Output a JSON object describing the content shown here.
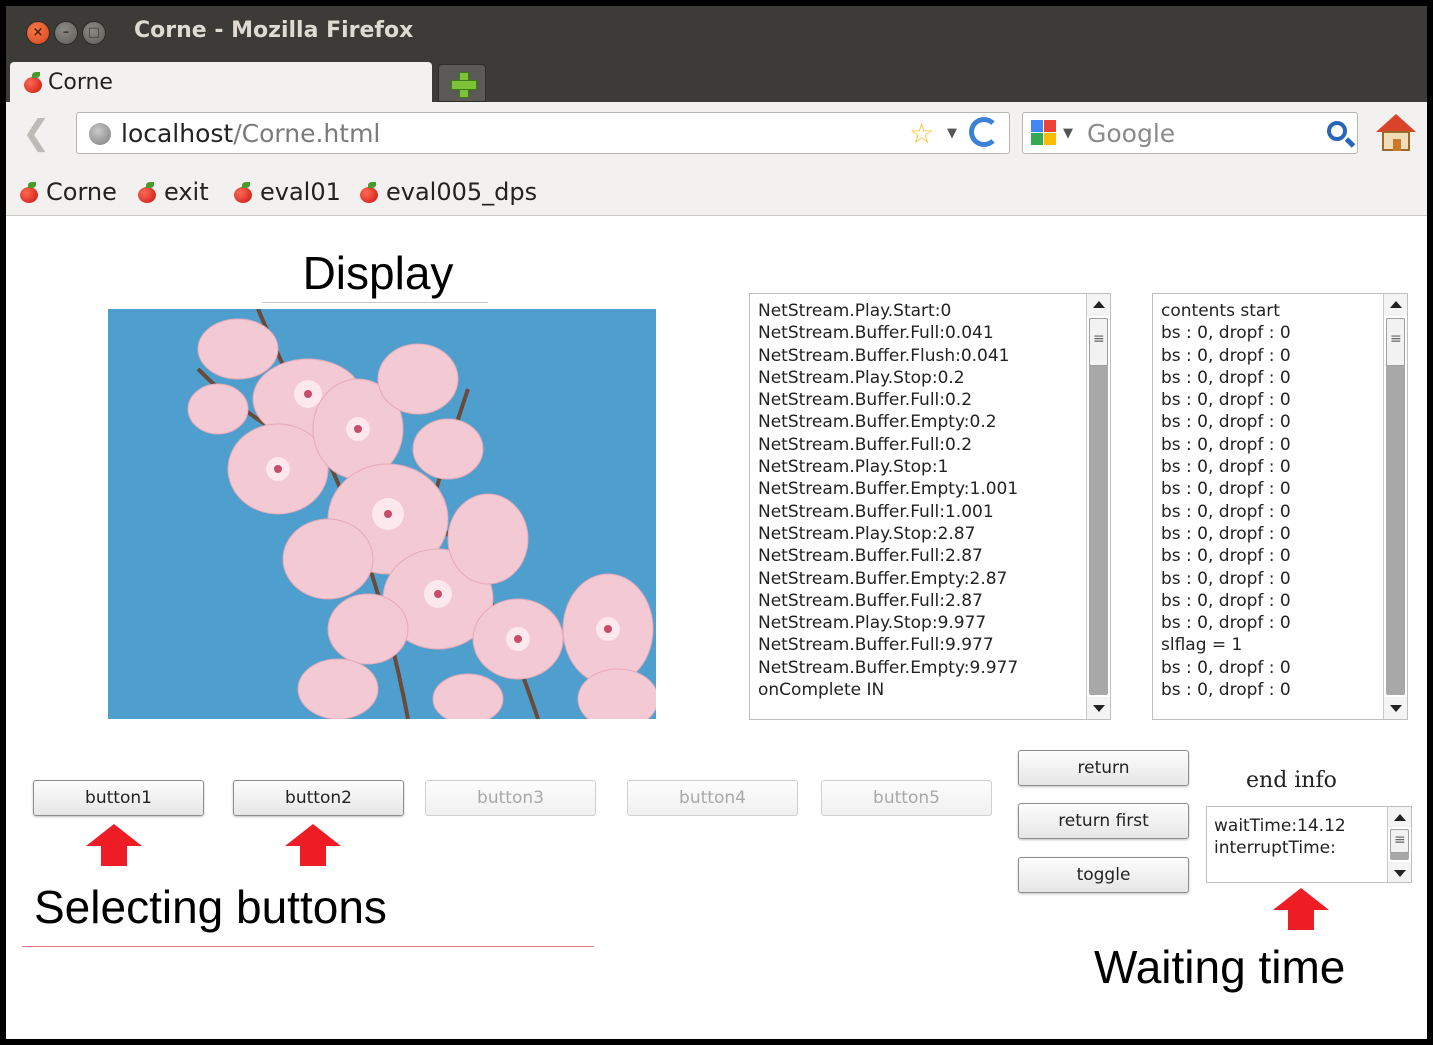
{
  "window": {
    "title": "Corne - Mozilla Firefox",
    "controls": {
      "close": "×",
      "minimize": "–",
      "maximize": "□"
    }
  },
  "tabs": [
    {
      "label": "Corne"
    }
  ],
  "navbar": {
    "url_host": "localhost",
    "url_path": "/Corne.html",
    "search_placeholder": "Google"
  },
  "bookmarks": [
    {
      "label": "Corne"
    },
    {
      "label": "exit"
    },
    {
      "label": "eval01"
    },
    {
      "label": "eval005_dps"
    }
  ],
  "annotations": {
    "display": "Display",
    "selecting_buttons": "Selecting buttons",
    "waiting_time": "Waiting time"
  },
  "log_left": [
    "NetStream.Play.Start:0",
    "NetStream.Buffer.Full:0.041",
    "NetStream.Buffer.Flush:0.041",
    "NetStream.Play.Stop:0.2",
    "NetStream.Buffer.Full:0.2",
    "NetStream.Buffer.Empty:0.2",
    "NetStream.Buffer.Full:0.2",
    "NetStream.Play.Stop:1",
    "NetStream.Buffer.Empty:1.001",
    "NetStream.Buffer.Full:1.001",
    "NetStream.Play.Stop:2.87",
    "NetStream.Buffer.Full:2.87",
    "NetStream.Buffer.Empty:2.87",
    "NetStream.Buffer.Full:2.87",
    "NetStream.Play.Stop:9.977",
    "NetStream.Buffer.Full:9.977",
    "NetStream.Buffer.Empty:9.977",
    "onComplete IN"
  ],
  "log_right": [
    "contents start",
    "bs : 0, dropf : 0",
    "bs : 0, dropf : 0",
    "bs : 0, dropf : 0",
    "bs : 0, dropf : 0",
    "bs : 0, dropf : 0",
    "bs : 0, dropf : 0",
    "bs : 0, dropf : 0",
    "bs : 0, dropf : 0",
    "bs : 0, dropf : 0",
    "bs : 0, dropf : 0",
    "bs : 0, dropf : 0",
    "bs : 0, dropf : 0",
    "bs : 0, dropf : 0",
    "bs : 0, dropf : 0",
    "slflag = 1",
    "bs : 0, dropf : 0",
    "bs : 0, dropf : 0"
  ],
  "buttons": {
    "button1": "button1",
    "button2": "button2",
    "button3": "button3",
    "button4": "button4",
    "button5": "button5",
    "return": "return",
    "return_first": "return first",
    "toggle": "toggle"
  },
  "end_info": {
    "label": "end info",
    "lines": [
      "waitTime:14.12",
      "interruptTime:"
    ]
  },
  "colors": {
    "titlebar": "#3c3b37",
    "chrome": "#f2f1f0",
    "annotation_arrow": "#ee1c25",
    "sky": "#4a9ccc",
    "blossom": "#f3c9d3"
  }
}
